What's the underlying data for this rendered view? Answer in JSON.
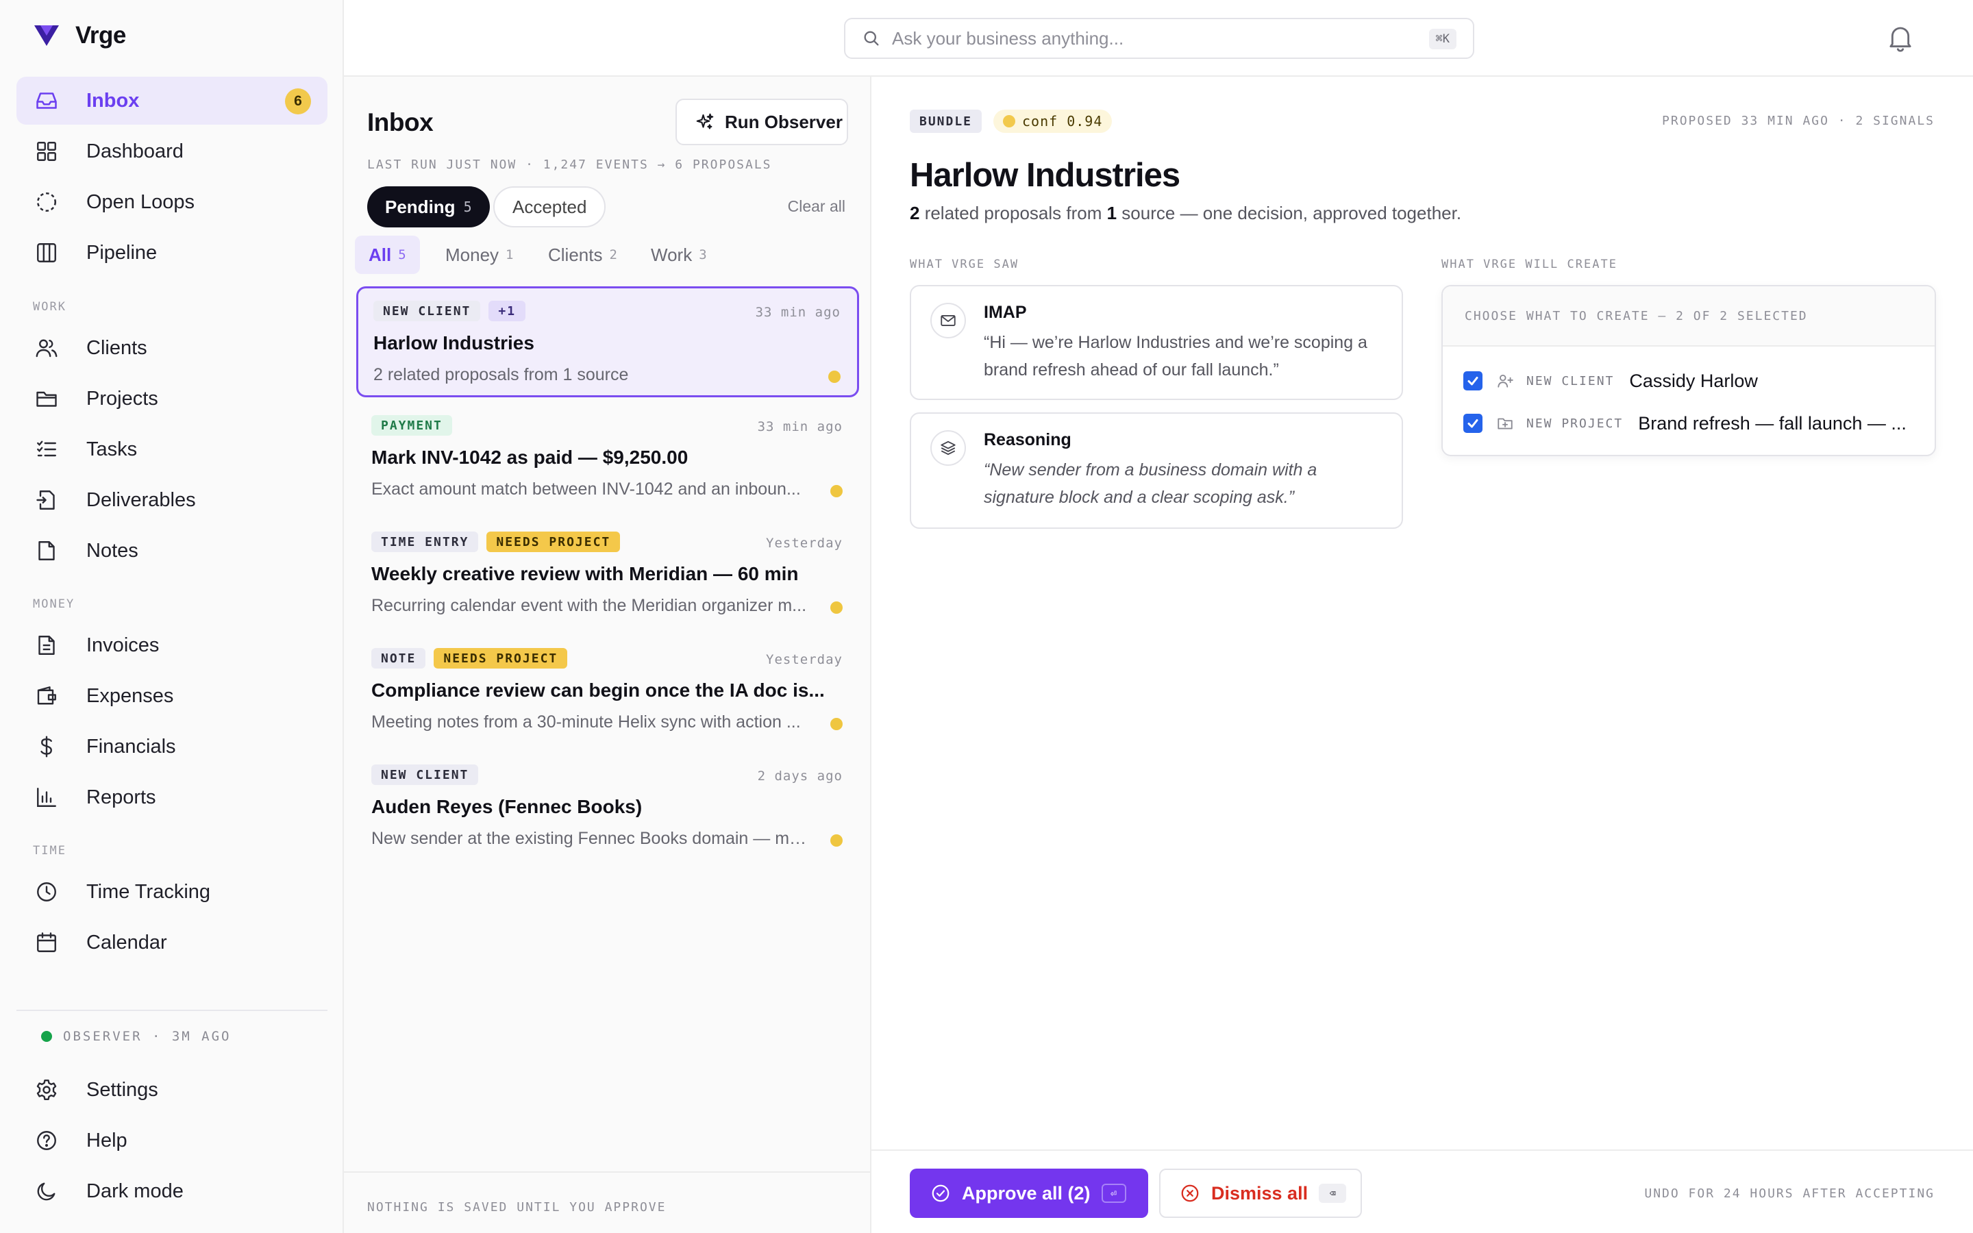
{
  "app": {
    "name": "Vrge",
    "accent": "#6b3ff0"
  },
  "sidebar": {
    "main": [
      {
        "label": "Inbox",
        "icon": "inbox-icon",
        "badge": "6",
        "active": true
      },
      {
        "label": "Dashboard",
        "icon": "dashboard-icon"
      },
      {
        "label": "Open Loops",
        "icon": "open-loops-icon"
      },
      {
        "label": "Pipeline",
        "icon": "pipeline-icon"
      }
    ],
    "work_label": "WORK",
    "work": [
      {
        "label": "Clients",
        "icon": "users-icon"
      },
      {
        "label": "Projects",
        "icon": "folder-icon"
      },
      {
        "label": "Tasks",
        "icon": "tasks-icon"
      },
      {
        "label": "Deliverables",
        "icon": "deliverables-icon"
      },
      {
        "label": "Notes",
        "icon": "note-icon"
      }
    ],
    "money_label": "MONEY",
    "money": [
      {
        "label": "Invoices",
        "icon": "invoice-icon"
      },
      {
        "label": "Expenses",
        "icon": "wallet-icon"
      },
      {
        "label": "Financials",
        "icon": "dollar-icon"
      },
      {
        "label": "Reports",
        "icon": "chart-icon"
      }
    ],
    "time_label": "TIME",
    "time": [
      {
        "label": "Time Tracking",
        "icon": "clock-icon"
      },
      {
        "label": "Calendar",
        "icon": "calendar-icon"
      }
    ],
    "observer_status": "OBSERVER · 3M AGO",
    "bottom": [
      {
        "label": "Settings",
        "icon": "gear-icon"
      },
      {
        "label": "Help",
        "icon": "help-icon"
      },
      {
        "label": "Dark mode",
        "icon": "moon-icon"
      }
    ]
  },
  "topbar": {
    "search_placeholder": "Ask your business anything...",
    "search_shortcut": "⌘K"
  },
  "inbox": {
    "title": "Inbox",
    "run_button": "Run Observer",
    "last_run": "LAST RUN JUST NOW · 1,247 EVENTS → 6 PROPOSALS",
    "segments": {
      "pending": "Pending",
      "pending_count": "5",
      "accepted": "Accepted"
    },
    "clear_all": "Clear all",
    "filters": [
      {
        "label": "All",
        "count": "5"
      },
      {
        "label": "Money",
        "count": "1"
      },
      {
        "label": "Clients",
        "count": "2"
      },
      {
        "label": "Work",
        "count": "3"
      }
    ],
    "items": [
      {
        "tags": [
          "NEW CLIENT",
          "+1"
        ],
        "time": "33 min ago",
        "title": "Harlow Industries",
        "subtitle": "2 related proposals from 1 source"
      },
      {
        "tags": [
          "PAYMENT"
        ],
        "time": "33 min ago",
        "title": "Mark INV-1042 as paid — $9,250.00",
        "subtitle": "Exact amount match between INV-1042 and an inboun..."
      },
      {
        "tags": [
          "TIME ENTRY",
          "NEEDS PROJECT"
        ],
        "time": "Yesterday",
        "title": "Weekly creative review with Meridian — 60 min",
        "subtitle": "Recurring calendar event with the Meridian organizer m..."
      },
      {
        "tags": [
          "NOTE",
          "NEEDS PROJECT"
        ],
        "time": "Yesterday",
        "title": "Compliance review can begin once the IA doc is...",
        "subtitle": "Meeting notes from a 30-minute Helix sync with action ..."
      },
      {
        "tags": [
          "NEW CLIENT"
        ],
        "time": "2 days ago",
        "title": "Auden Reyes (Fennec Books)",
        "subtitle": "New sender at the existing Fennec Books domain — ma..."
      }
    ],
    "footer": "NOTHING IS SAVED UNTIL YOU APPROVE"
  },
  "detail": {
    "bundle_tag": "BUNDLE",
    "confidence": "conf 0.94",
    "proposed_meta": "PROPOSED 33 MIN AGO · 2 SIGNALS",
    "title": "Harlow Industries",
    "subtitle_parts": [
      "2",
      " related proposals from ",
      "1",
      " source — one decision, approved together."
    ],
    "saw_label": "WHAT VRGE SAW",
    "create_label": "WHAT VRGE WILL CREATE",
    "signals": [
      {
        "heading": "IMAP",
        "icon": "mail-icon",
        "body": "“Hi — we’re Harlow Industries and we’re scoping a brand refresh ahead of our fall launch.”"
      },
      {
        "heading": "Reasoning",
        "icon": "layers-icon",
        "body": "“New sender from a business domain with a signature block and a clear scoping ask.”"
      }
    ],
    "create_header": "CHOOSE WHAT TO CREATE — 2 OF 2 SELECTED",
    "create_items": [
      {
        "checked": true,
        "icon": "user-plus-icon",
        "kind": "NEW CLIENT",
        "name": "Cassidy Harlow"
      },
      {
        "checked": true,
        "icon": "folder-plus-icon",
        "kind": "NEW PROJECT",
        "name": "Brand refresh — fall launch — ..."
      }
    ],
    "approve_label": "Approve all (2)",
    "approve_key": "⏎",
    "dismiss_label": "Dismiss all",
    "dismiss_key": "⌫",
    "undo_note": "UNDO FOR 24 HOURS AFTER ACCEPTING"
  }
}
